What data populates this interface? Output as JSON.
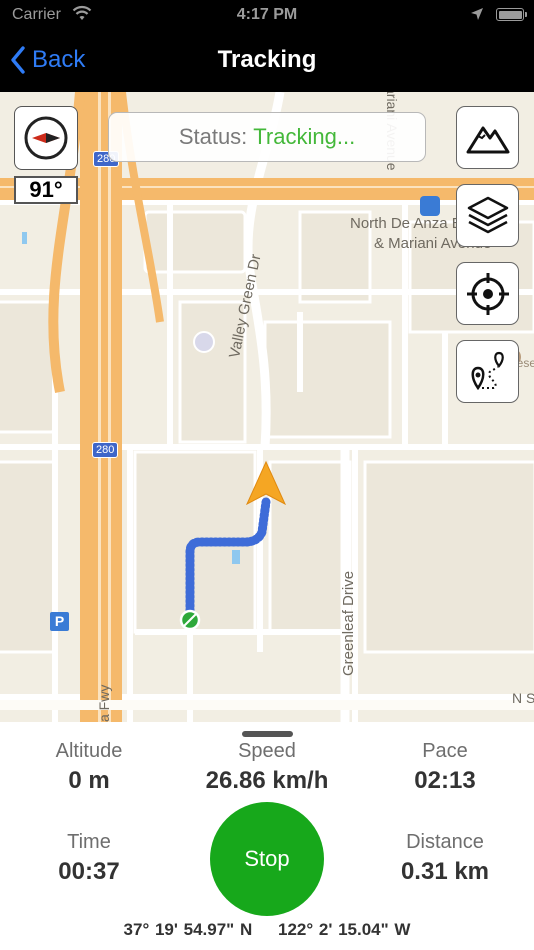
{
  "status_bar": {
    "carrier": "Carrier",
    "time": "4:17 PM"
  },
  "nav": {
    "back_label": "Back",
    "title": "Tracking"
  },
  "map": {
    "heading": "91°",
    "status_label": "Status:",
    "status_value": "Tracking...",
    "labels": {
      "avenue": "ariani Avenue",
      "stop_line1": "North De Anza Bo",
      "stop_line2": "& Mariani Avenue",
      "valley_green": "Valley Green Dr",
      "greenleaf": "Greenleaf Drive",
      "church": "Chinese Church",
      "fwy": "a Fwy",
      "shield_280": "280",
      "ns": "N S",
      "parking": "P"
    },
    "buttons": [
      "terrain-button",
      "layers-button",
      "locate-button",
      "route-button"
    ]
  },
  "stats": {
    "altitude": {
      "label": "Altitude",
      "value": "0 m"
    },
    "speed": {
      "label": "Speed",
      "value": "26.86 km/h"
    },
    "pace": {
      "label": "Pace",
      "value": "02:13"
    },
    "time": {
      "label": "Time",
      "value": "00:37"
    },
    "distance": {
      "label": "Distance",
      "value": "0.31 km"
    }
  },
  "stop_label": "Stop",
  "coords": {
    "lat": "37° 19' 54.97\" N",
    "lon": "122° 2' 15.04\" W"
  },
  "colors": {
    "accent": "#2f7cf6",
    "tracking": "#44b83a",
    "stop": "#17a81b",
    "highway": "#f5b96b",
    "track": "#3e6cd8"
  }
}
